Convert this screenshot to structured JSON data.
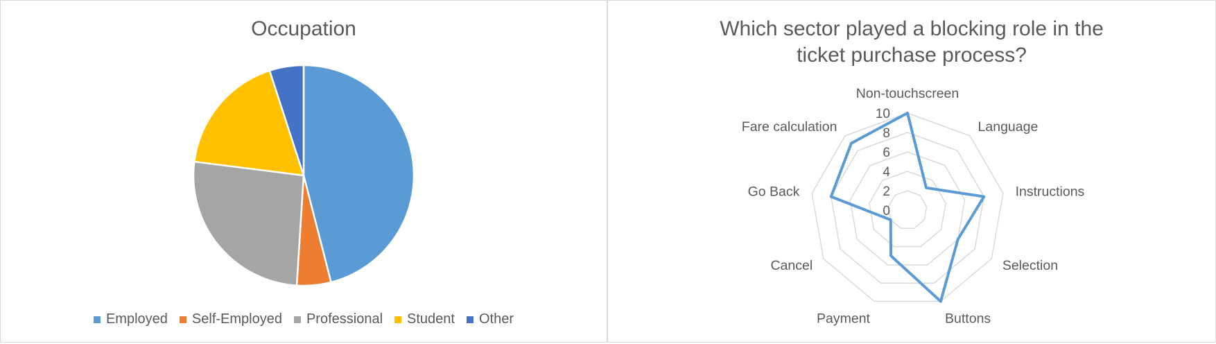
{
  "chart_data": [
    {
      "type": "pie",
      "title": "Occupation",
      "categories": [
        "Employed",
        "Self-Employed",
        "Professional",
        "Student",
        "Other"
      ],
      "values": [
        46,
        5,
        26,
        18,
        5
      ],
      "colors": [
        "#5b9bd5",
        "#ed7d31",
        "#a5a5a5",
        "#ffc000",
        "#4472c4"
      ],
      "legend_position": "bottom"
    },
    {
      "type": "radar",
      "title": "Which sector played a blocking role in the ticket purchase process?",
      "categories": [
        "Non-touchscreen",
        "Language",
        "Instructions",
        "Selection",
        "Buttons",
        "Payment",
        "Cancel",
        "Go Back",
        "Fare calculation"
      ],
      "values": [
        10,
        3,
        8,
        6,
        10,
        5,
        2,
        8,
        9
      ],
      "ylim": [
        0,
        10
      ],
      "tick_labels": [
        "0",
        "2",
        "4",
        "6",
        "8",
        "10"
      ],
      "series_color": "#5b9bd5",
      "grid": true
    }
  ]
}
